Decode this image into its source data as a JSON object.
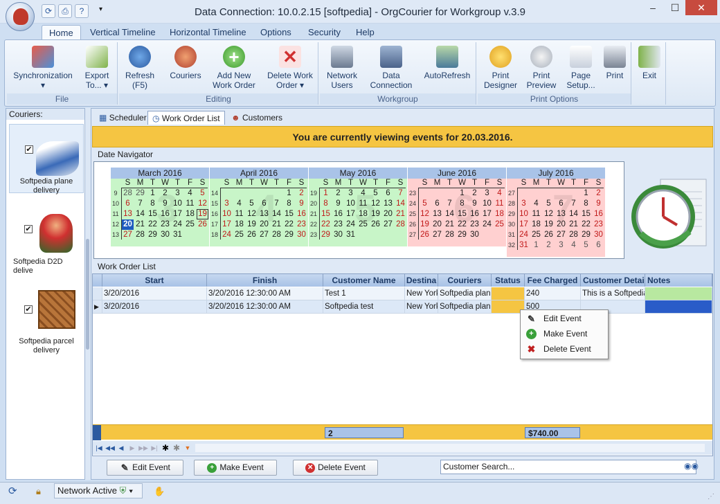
{
  "window": {
    "title": "Data Connection: 10.0.2.15 [softpedia] - OrgCourier for Workgroup v.3.9",
    "min": "–",
    "max": "☐",
    "close": "✕"
  },
  "ribbon_tabs": [
    "Home",
    "Vertical Timeline",
    "Horizontal Timeline",
    "Options",
    "Security",
    "Help"
  ],
  "ribbon": {
    "file": {
      "label": "File",
      "sync": "Synchronization",
      "sync_arrow": "▾",
      "export1": "Export",
      "export2": "To... ▾"
    },
    "editing": {
      "label": "Editing",
      "refresh1": "Refresh",
      "refresh2": "(F5)",
      "couriers": "Couriers",
      "add1": "Add New",
      "add2": "Work Order",
      "del1": "Delete Work",
      "del2": "Order ▾"
    },
    "workgroup": {
      "label": "Workgroup",
      "net1": "Network",
      "net2": "Users",
      "data1": "Data",
      "data2": "Connection",
      "auto": "AutoRefresh"
    },
    "print": {
      "label": "Print Options",
      "pd1": "Print",
      "pd2": "Designer",
      "pp1": "Print",
      "pp2": "Preview",
      "ps1": "Page",
      "ps2": "Setup...",
      "print": "Print"
    },
    "exit": "Exit"
  },
  "couriers": {
    "header": "Couriers:",
    "items": [
      {
        "name1": "Softpedia plane",
        "name2": "delivery"
      },
      {
        "name1": "Softpedia D2D delive",
        "name2": ""
      },
      {
        "name1": "Softpedia parcel",
        "name2": "delivery"
      }
    ]
  },
  "view_tabs": [
    "Scheduler",
    "Work Order List",
    "Customers"
  ],
  "banner": "You are currently viewing events for 20.03.2016.",
  "date_navigator": {
    "label": "Date Navigator",
    "dow": [
      "S",
      "M",
      "T",
      "W",
      "T",
      "F",
      "S"
    ],
    "months": [
      {
        "name": "March 2016",
        "big": "3",
        "weeks": [
          "9",
          "10",
          "11",
          "12",
          "13"
        ],
        "rows": [
          [
            "28",
            "29",
            "1",
            "2",
            "3",
            "4",
            "5"
          ],
          [
            "6",
            "7",
            "8",
            "9",
            "10",
            "11",
            "12"
          ],
          [
            "13",
            "14",
            "15",
            "16",
            "17",
            "18",
            "19"
          ],
          [
            "20",
            "21",
            "22",
            "23",
            "24",
            "25",
            "26"
          ],
          [
            "27",
            "28",
            "29",
            "30",
            "31",
            "",
            ""
          ]
        ]
      },
      {
        "name": "April 2016",
        "big": "4",
        "weeks": [
          "14",
          "15",
          "16",
          "17",
          "18"
        ],
        "rows": [
          [
            "",
            "",
            "",
            "",
            "",
            "1",
            "2"
          ],
          [
            "3",
            "4",
            "5",
            "6",
            "7",
            "8",
            "9"
          ],
          [
            "10",
            "11",
            "12",
            "13",
            "14",
            "15",
            "16"
          ],
          [
            "17",
            "18",
            "19",
            "20",
            "21",
            "22",
            "23"
          ],
          [
            "24",
            "25",
            "26",
            "27",
            "28",
            "29",
            "30"
          ]
        ]
      },
      {
        "name": "May 2016",
        "big": "5",
        "weeks": [
          "19",
          "20",
          "21",
          "22",
          "23"
        ],
        "rows": [
          [
            "1",
            "2",
            "3",
            "4",
            "5",
            "6",
            "7"
          ],
          [
            "8",
            "9",
            "10",
            "11",
            "12",
            "13",
            "14"
          ],
          [
            "15",
            "16",
            "17",
            "18",
            "19",
            "20",
            "21"
          ],
          [
            "22",
            "23",
            "24",
            "25",
            "26",
            "27",
            "28"
          ],
          [
            "29",
            "30",
            "31",
            "",
            "",
            "",
            ""
          ]
        ]
      },
      {
        "name": "June 2016",
        "big": "6",
        "weeks": [
          "23",
          "24",
          "25",
          "26",
          "27"
        ],
        "rows": [
          [
            "",
            "",
            "",
            "1",
            "2",
            "3",
            "4"
          ],
          [
            "5",
            "6",
            "7",
            "8",
            "9",
            "10",
            "11"
          ],
          [
            "12",
            "13",
            "14",
            "15",
            "16",
            "17",
            "18"
          ],
          [
            "19",
            "20",
            "21",
            "22",
            "23",
            "24",
            "25"
          ],
          [
            "26",
            "27",
            "28",
            "29",
            "30",
            "",
            ""
          ]
        ]
      },
      {
        "name": "July 2016",
        "big": "7",
        "weeks": [
          "27",
          "28",
          "29",
          "30",
          "31",
          "32"
        ],
        "rows": [
          [
            "",
            "",
            "",
            "",
            "",
            "1",
            "2"
          ],
          [
            "3",
            "4",
            "5",
            "6",
            "7",
            "8",
            "9"
          ],
          [
            "10",
            "11",
            "12",
            "13",
            "14",
            "15",
            "16"
          ],
          [
            "17",
            "18",
            "19",
            "20",
            "21",
            "22",
            "23"
          ],
          [
            "24",
            "25",
            "26",
            "27",
            "28",
            "29",
            "30"
          ],
          [
            "31",
            "1",
            "2",
            "3",
            "4",
            "5",
            "6"
          ]
        ]
      }
    ]
  },
  "work_order_list": {
    "label": "Work Order List",
    "columns": [
      "Start",
      "Finish",
      "Customer Name",
      "Destina",
      "Couriers",
      "Status",
      "Fee Charged",
      "Customer Detai",
      "Notes"
    ],
    "rows": [
      [
        "3/20/2016",
        "3/20/2016 12:30:00 AM",
        "Test 1",
        "New York",
        "Softpedia plane",
        "",
        "240",
        "This is a Softpedia",
        ""
      ],
      [
        "3/20/2016",
        "3/20/2016 12:30:00 AM",
        "Softpedia test",
        "New York",
        "Softpedia plane",
        "",
        "500",
        "",
        ""
      ]
    ],
    "footer_count": "2",
    "footer_fee": "$740.00"
  },
  "context_menu": [
    "Edit Event",
    "Make Event",
    "Delete Event"
  ],
  "buttons": {
    "edit": "Edit Event",
    "make": "Make Event",
    "delete": "Delete Event"
  },
  "search": {
    "placeholder": "Customer Search..."
  },
  "status": {
    "network": "Network Active"
  },
  "colors": {
    "green_month": "#c8f5c8",
    "red_month": "#ffd0d0",
    "banner": "#f5c542",
    "accent": "#2b5aa0"
  }
}
